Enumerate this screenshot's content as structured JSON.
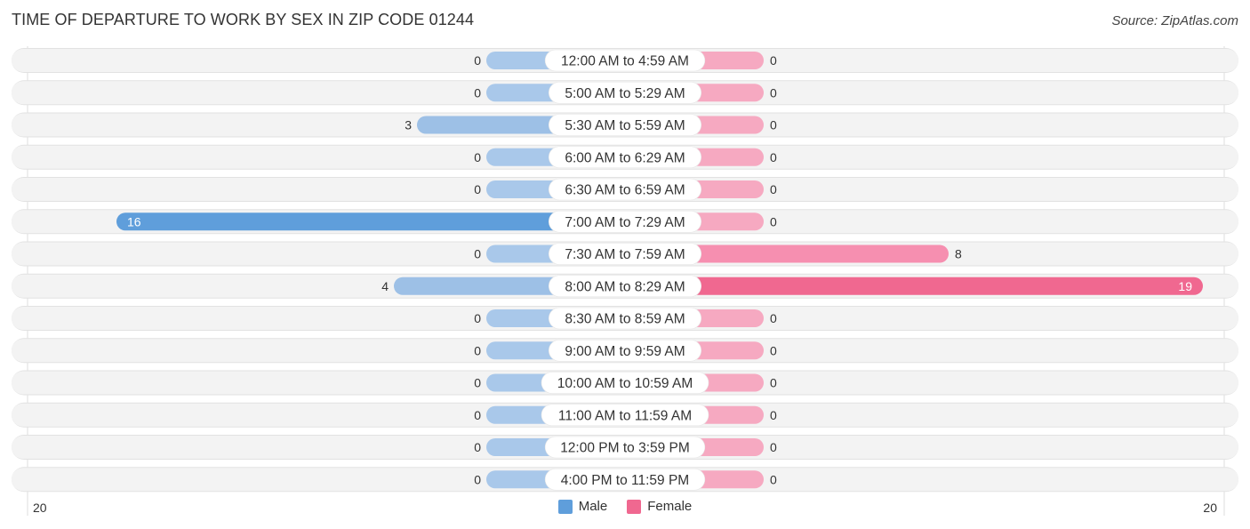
{
  "header": {
    "title": "TIME OF DEPARTURE TO WORK BY SEX IN ZIP CODE 01244",
    "source": "Source: ZipAtlas.com"
  },
  "colors": {
    "male_light": "#a9c8ea",
    "male_strong": "#5f9edb",
    "female_light": "#f6a9c1",
    "female_strong": "#f06890",
    "row_bg": "#f3f3f3"
  },
  "chart_data": {
    "type": "bar",
    "orientation": "horizontal-diverging",
    "title": "TIME OF DEPARTURE TO WORK BY SEX IN ZIP CODE 01244",
    "categories": [
      "12:00 AM to 4:59 AM",
      "5:00 AM to 5:29 AM",
      "5:30 AM to 5:59 AM",
      "6:00 AM to 6:29 AM",
      "6:30 AM to 6:59 AM",
      "7:00 AM to 7:29 AM",
      "7:30 AM to 7:59 AM",
      "8:00 AM to 8:29 AM",
      "8:30 AM to 8:59 AM",
      "9:00 AM to 9:59 AM",
      "10:00 AM to 10:59 AM",
      "11:00 AM to 11:59 AM",
      "12:00 PM to 3:59 PM",
      "4:00 PM to 11:59 PM"
    ],
    "series": [
      {
        "name": "Male",
        "values": [
          0,
          0,
          3,
          0,
          0,
          16,
          0,
          4,
          0,
          0,
          0,
          0,
          0,
          0
        ]
      },
      {
        "name": "Female",
        "values": [
          0,
          0,
          0,
          0,
          0,
          0,
          8,
          19,
          0,
          0,
          0,
          0,
          0,
          0
        ]
      }
    ],
    "axis": {
      "left_label": "20",
      "right_label": "20",
      "range": [
        0,
        20
      ]
    },
    "legend": {
      "position": "bottom-center",
      "entries": [
        "Male",
        "Female"
      ]
    }
  }
}
